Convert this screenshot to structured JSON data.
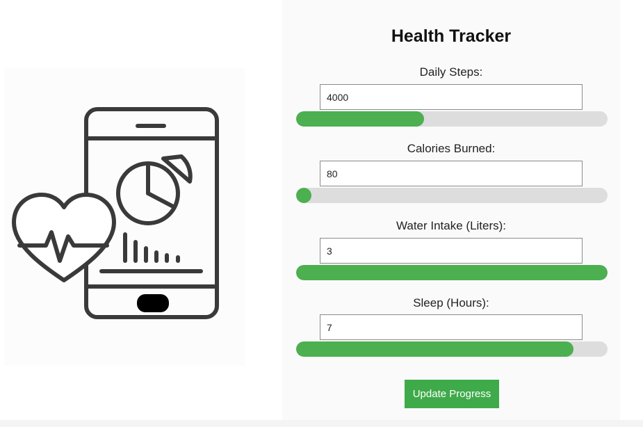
{
  "illustration": {
    "icon": "phone-health-icon"
  },
  "tracker": {
    "title": "Health Tracker",
    "metrics": [
      {
        "label": "Daily Steps:",
        "value": "4000",
        "progress": 0.41
      },
      {
        "label": "Calories Burned:",
        "value": "80",
        "progress": 0.05
      },
      {
        "label": "Water Intake (Liters):",
        "value": "3",
        "progress": 1.0
      },
      {
        "label": "Sleep (Hours):",
        "value": "7",
        "progress": 0.89
      }
    ],
    "button_label": "Update Progress"
  },
  "colors": {
    "accent": "#4caf50",
    "button": "#3faa4a",
    "track": "#dddddd",
    "icon_stroke": "#3a3a3a"
  }
}
